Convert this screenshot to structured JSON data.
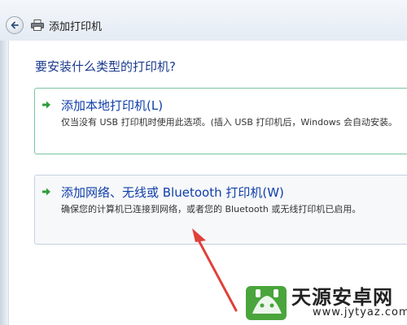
{
  "window": {
    "title": "添加打印机",
    "icons": {
      "back": "back-arrow-icon",
      "printer": "printer-icon"
    }
  },
  "main": {
    "question": "要安装什么类型的打印机?",
    "options": [
      {
        "title": "添加本地打印机(L)",
        "description": "仅当没有 USB 打印机时使用此选项。(插入 USB 打印机后，Windows 会自动安装。",
        "icon": "green-arrow-icon"
      },
      {
        "title": "添加网络、无线或 Bluetooth 打印机(W)",
        "description": "确保您的计算机已连接到网络，或者您的 Bluetooth 或无线打印机已启用。",
        "icon": "green-arrow-icon"
      }
    ]
  },
  "watermark": {
    "name": "天源安卓网",
    "url": "www.jytyaz.com"
  },
  "colors": {
    "accent_text": "#0f3ea8",
    "heading_text": "#1a3a8c",
    "arrow_green": "#2e9c3a",
    "annotation_red": "#e0403a"
  }
}
